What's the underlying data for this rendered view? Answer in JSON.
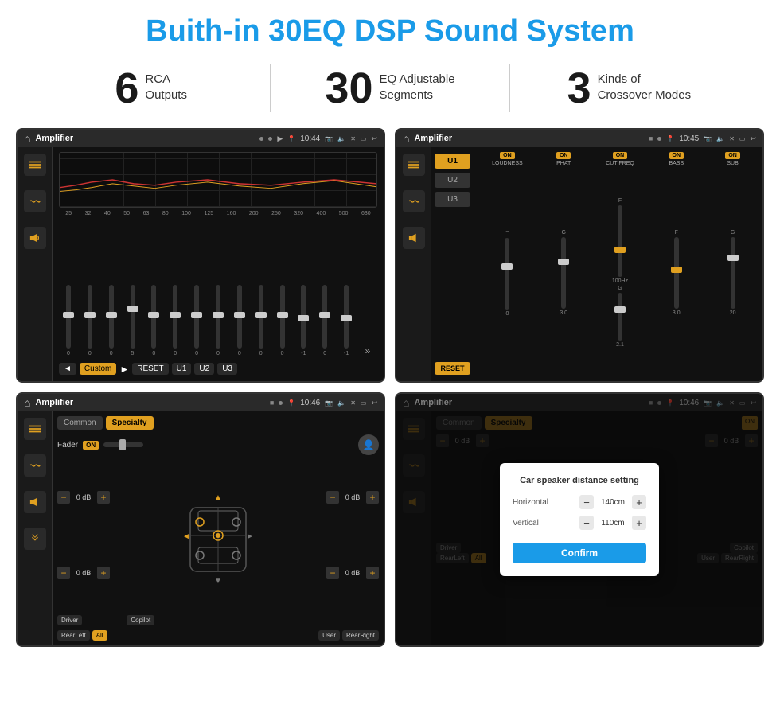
{
  "page": {
    "title": "Buith-in 30EQ DSP Sound System",
    "background": "#ffffff"
  },
  "stats": [
    {
      "number": "6",
      "label": "RCA\nOutputs"
    },
    {
      "number": "30",
      "label": "EQ Adjustable\nSegments"
    },
    {
      "number": "3",
      "label": "Kinds of\nCrossover Modes"
    }
  ],
  "screen1": {
    "status_title": "Amplifier",
    "time": "10:44",
    "eq_labels": [
      "25",
      "32",
      "40",
      "50",
      "63",
      "80",
      "100",
      "125",
      "160",
      "200",
      "250",
      "320",
      "400",
      "500",
      "630"
    ],
    "eq_values": [
      "0",
      "0",
      "0",
      "5",
      "0",
      "0",
      "0",
      "0",
      "0",
      "0",
      "0",
      "-1",
      "0",
      "-1"
    ],
    "buttons": [
      "Custom",
      "RESET",
      "U1",
      "U2",
      "U3"
    ]
  },
  "screen2": {
    "status_title": "Amplifier",
    "time": "10:45",
    "presets": [
      "U1",
      "U2",
      "U3"
    ],
    "channels": [
      {
        "label": "LOUDNESS",
        "on": true
      },
      {
        "label": "PHAT",
        "on": true
      },
      {
        "label": "CUT FREQ",
        "on": true
      },
      {
        "label": "BASS",
        "on": true
      },
      {
        "label": "SUB",
        "on": true
      }
    ],
    "reset_btn": "RESET"
  },
  "screen3": {
    "status_title": "Amplifier",
    "time": "10:46",
    "tabs": [
      "Common",
      "Specialty"
    ],
    "active_tab": "Specialty",
    "fader_label": "Fader",
    "fader_on": "ON",
    "speaker_rows": [
      {
        "label1": "— 0 dB +",
        "label2": "— 0 dB +"
      },
      {
        "label1": "— 0 dB +",
        "label2": "— 0 dB +"
      }
    ],
    "location_btns": [
      "Driver",
      "Copilot",
      "RearLeft",
      "All",
      "User",
      "RearRight"
    ]
  },
  "screen4": {
    "status_title": "Amplifier",
    "time": "10:46",
    "tabs": [
      "Common",
      "Specialty"
    ],
    "dialog": {
      "title": "Car speaker distance setting",
      "horizontal_label": "Horizontal",
      "horizontal_value": "140cm",
      "vertical_label": "Vertical",
      "vertical_value": "110cm",
      "confirm_label": "Confirm"
    },
    "location_btns": [
      "Driver",
      "Copilot",
      "RearLeft",
      "All",
      "User",
      "RearRight"
    ]
  }
}
